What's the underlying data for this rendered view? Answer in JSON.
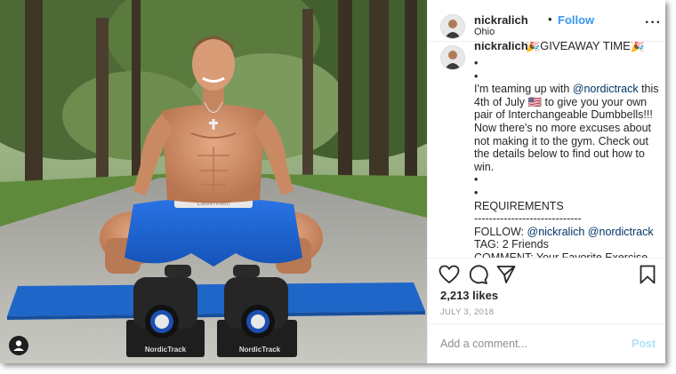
{
  "header": {
    "username": "nickralich",
    "separator": "•",
    "follow_label": "Follow",
    "location": "Ohio",
    "more_icon": "more-options-icon"
  },
  "caption": {
    "username": "nickralich",
    "giveaway_text": "🎉GIVEAWAY TIME🎉",
    "text_lines": [
      "•",
      "•",
      "I'm teaming up with ",
      "@nordictrack",
      " this 4th of July 🇺🇸 to give you your own pair of Interchangeable Dumbbells!!! Now there's no more excuses about not making it to the gym. Check out the details below to find out how to win.",
      "•",
      "•",
      "REQUIREMENTS",
      "-----------------------------",
      "FOLLOW: ",
      "@nickralich",
      " ",
      "@nordictrack",
      "TAG: 2 Friends",
      "COMMENT: Your Favorite Exercise"
    ]
  },
  "actions": {
    "like_icon": "heart-icon",
    "comment_icon": "comment-icon",
    "share_icon": "share-icon",
    "save_icon": "bookmark-icon"
  },
  "likes": "2,213 likes",
  "date": "JULY 3, 2018",
  "comment_box": {
    "placeholder": "Add a comment...",
    "post_label": "Post"
  },
  "photo": {
    "tag_icon": "tagged-user-icon",
    "brand_left": "NordicTrack",
    "brand_right": "NordicTrack",
    "waistband_text": "Calvin Klein"
  },
  "colors": {
    "link": "#3897f0",
    "mention": "#003569",
    "post_disabled": "#b2dffc",
    "mat": "#1f66c9",
    "shorts": "#1d63d6"
  }
}
